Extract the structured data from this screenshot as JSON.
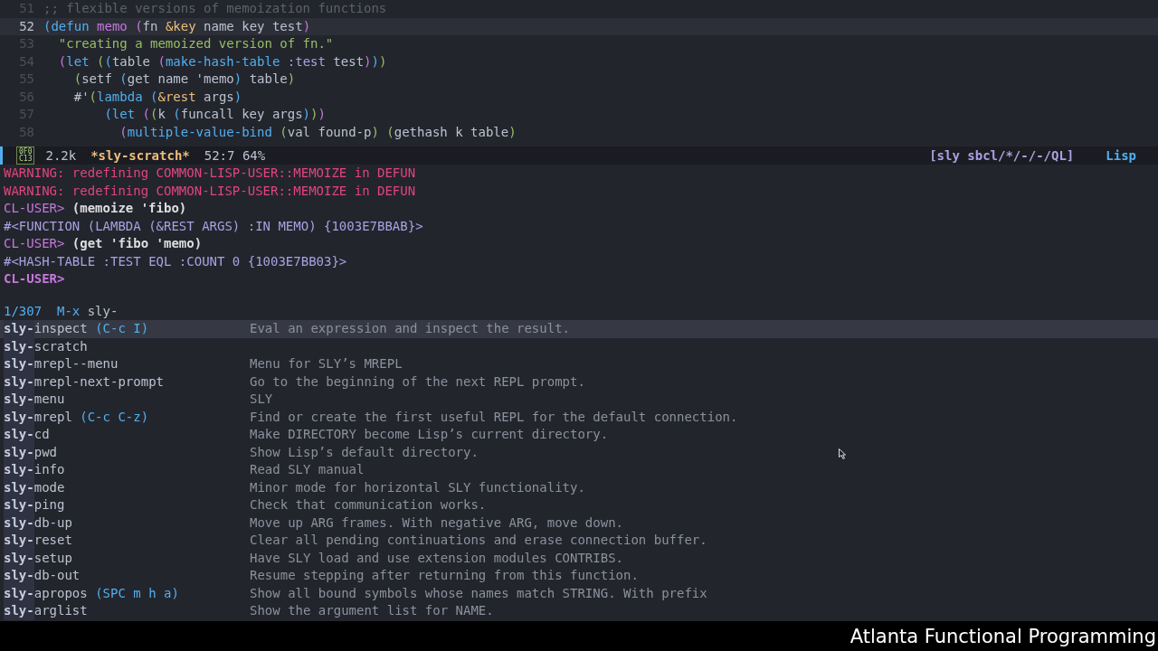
{
  "editor": {
    "lines": [
      {
        "number": "51",
        "current": false,
        "segments": [
          {
            "kind": "comment",
            "text": ";; flexible versions of memoization functions"
          }
        ]
      },
      {
        "number": "52",
        "current": true,
        "segments": [
          {
            "kind": "p1",
            "text": "("
          },
          {
            "kind": "keyword",
            "text": "defun"
          },
          {
            "kind": "fn",
            "text": " memo"
          },
          {
            "kind": "p2",
            "text": " ("
          },
          {
            "kind": "plain",
            "text": "fn "
          },
          {
            "kind": "amp",
            "text": "&key"
          },
          {
            "kind": "plain",
            "text": " name key test"
          },
          {
            "kind": "p2",
            "text": ")"
          }
        ]
      },
      {
        "number": "53",
        "current": false,
        "segments": [
          {
            "kind": "string",
            "text": "  \"creating a memoized version of fn.\""
          }
        ]
      },
      {
        "number": "54",
        "current": false,
        "segments": [
          {
            "kind": "p2",
            "text": "  ("
          },
          {
            "kind": "keyword",
            "text": "let"
          },
          {
            "kind": "p3",
            "text": " ("
          },
          {
            "kind": "p1",
            "text": "("
          },
          {
            "kind": "plain",
            "text": "table "
          },
          {
            "kind": "p2",
            "text": "("
          },
          {
            "kind": "keyword",
            "text": "make-hash-table"
          },
          {
            "kind": "symbol",
            "text": " :test"
          },
          {
            "kind": "plain",
            "text": " test"
          },
          {
            "kind": "p2",
            "text": ")"
          },
          {
            "kind": "p1",
            "text": ")"
          },
          {
            "kind": "p3",
            "text": ")"
          }
        ]
      },
      {
        "number": "55",
        "current": false,
        "segments": [
          {
            "kind": "p3",
            "text": "    ("
          },
          {
            "kind": "plain",
            "text": "setf "
          },
          {
            "kind": "p1",
            "text": "("
          },
          {
            "kind": "plain",
            "text": "get name 'memo"
          },
          {
            "kind": "p1",
            "text": ")"
          },
          {
            "kind": "plain",
            "text": " table"
          },
          {
            "kind": "p3",
            "text": ")"
          }
        ]
      },
      {
        "number": "56",
        "current": false,
        "segments": [
          {
            "kind": "plain",
            "text": "    #'"
          },
          {
            "kind": "p3",
            "text": "("
          },
          {
            "kind": "keyword",
            "text": "lambda"
          },
          {
            "kind": "p1",
            "text": " ("
          },
          {
            "kind": "amp",
            "text": "&rest"
          },
          {
            "kind": "plain",
            "text": " args"
          },
          {
            "kind": "p1",
            "text": ")"
          }
        ]
      },
      {
        "number": "57",
        "current": false,
        "segments": [
          {
            "kind": "p1",
            "text": "        ("
          },
          {
            "kind": "keyword",
            "text": "let"
          },
          {
            "kind": "p2",
            "text": " ("
          },
          {
            "kind": "p3",
            "text": "("
          },
          {
            "kind": "plain",
            "text": "k "
          },
          {
            "kind": "p1",
            "text": "("
          },
          {
            "kind": "plain",
            "text": "funcall key args"
          },
          {
            "kind": "p1",
            "text": ")"
          },
          {
            "kind": "p3",
            "text": ")"
          },
          {
            "kind": "p2",
            "text": ")"
          }
        ]
      },
      {
        "number": "58",
        "current": false,
        "segments": [
          {
            "kind": "p2",
            "text": "          ("
          },
          {
            "kind": "keyword",
            "text": "multiple-value-bind"
          },
          {
            "kind": "p3",
            "text": " ("
          },
          {
            "kind": "plain",
            "text": "val found-p"
          },
          {
            "kind": "p3",
            "text": ")"
          },
          {
            "kind": "p3",
            "text": " ("
          },
          {
            "kind": "plain",
            "text": "gethash k table"
          },
          {
            "kind": "p3",
            "text": ")"
          }
        ]
      }
    ]
  },
  "mode_line": {
    "glyph": [
      "0F0",
      "C13"
    ],
    "size": "2.2k",
    "buffer": "*sly-scratch*",
    "position": "52:7 64%",
    "connection": "[sly sbcl/*/-/-/QL]",
    "major_mode": "Lisp"
  },
  "repl": [
    {
      "kind": "warning",
      "text": "WARNING: redefining COMMON-LISP-USER::MEMOIZE in DEFUN"
    },
    {
      "kind": "warning",
      "text": "WARNING: redefining COMMON-LISP-USER::MEMOIZE in DEFUN"
    },
    {
      "kind": "input",
      "prompt": "CL-USER>",
      "text": "(memoize 'fibo)"
    },
    {
      "kind": "output",
      "text": "#<FUNCTION (LAMBDA (&REST ARGS) :IN MEMO) {1003E7BBAB}>"
    },
    {
      "kind": "input",
      "prompt": "CL-USER>",
      "text": "(get 'fibo 'memo)"
    },
    {
      "kind": "output",
      "text": "#<HASH-TABLE :TEST EQL :COUNT 0 {1003E7BB03}>"
    },
    {
      "kind": "prompt",
      "prompt": "CL-USER>"
    }
  ],
  "minibuffer": {
    "count": "1/307",
    "command": "M-x",
    "input": "sly-"
  },
  "candidates": [
    {
      "match": "sly-",
      "name": "inspect",
      "binding": "(C-c I)",
      "description": "Eval an expression and inspect the result.",
      "selected": true
    },
    {
      "match": "sly-",
      "name": "scratch",
      "selected": false
    },
    {
      "match": "sly-",
      "name": "mrepl--menu",
      "description": "Menu for SLY’s MREPL",
      "selected": false
    },
    {
      "match": "sly-",
      "name": "mrepl-next-prompt",
      "description": "Go to the beginning of the next REPL prompt.",
      "selected": false
    },
    {
      "match": "sly-",
      "name": "menu",
      "description": "SLY",
      "selected": false
    },
    {
      "match": "sly-",
      "name": "mrepl",
      "binding": "(C-c C-z)",
      "description": "Find or create the first useful REPL for the default connection.",
      "selected": false
    },
    {
      "match": "sly-",
      "name": "cd",
      "description": "Make DIRECTORY become Lisp’s current directory.",
      "selected": false
    },
    {
      "match": "sly-",
      "name": "pwd",
      "description": "Show Lisp’s default directory.",
      "selected": false
    },
    {
      "match": "sly-",
      "name": "info",
      "description": "Read SLY manual",
      "selected": false
    },
    {
      "match": "sly-",
      "name": "mode",
      "description": "Minor mode for horizontal SLY functionality.",
      "selected": false
    },
    {
      "match": "sly-",
      "name": "ping",
      "description": "Check that communication works.",
      "selected": false
    },
    {
      "match": "sly-",
      "name": "db-up",
      "description": "Move up ARG frames. With negative ARG, move down.",
      "selected": false
    },
    {
      "match": "sly-",
      "name": "reset",
      "description": "Clear all pending continuations and erase connection buffer.",
      "selected": false
    },
    {
      "match": "sly-",
      "name": "setup",
      "description": "Have SLY load and use extension modules CONTRIBS.",
      "selected": false
    },
    {
      "match": "sly-",
      "name": "db-out",
      "description": "Resume stepping after returning from this function.",
      "selected": false
    },
    {
      "match": "sly-",
      "name": "apropos",
      "binding": "(SPC m h a)",
      "description": "Show all bound symbols whose names match STRING. With prefix",
      "selected": false
    },
    {
      "match": "sly-",
      "name": "arglist",
      "description": "Show the argument list for NAME.",
      "selected": false
    }
  ],
  "caption": "Atlanta Functional Programming"
}
